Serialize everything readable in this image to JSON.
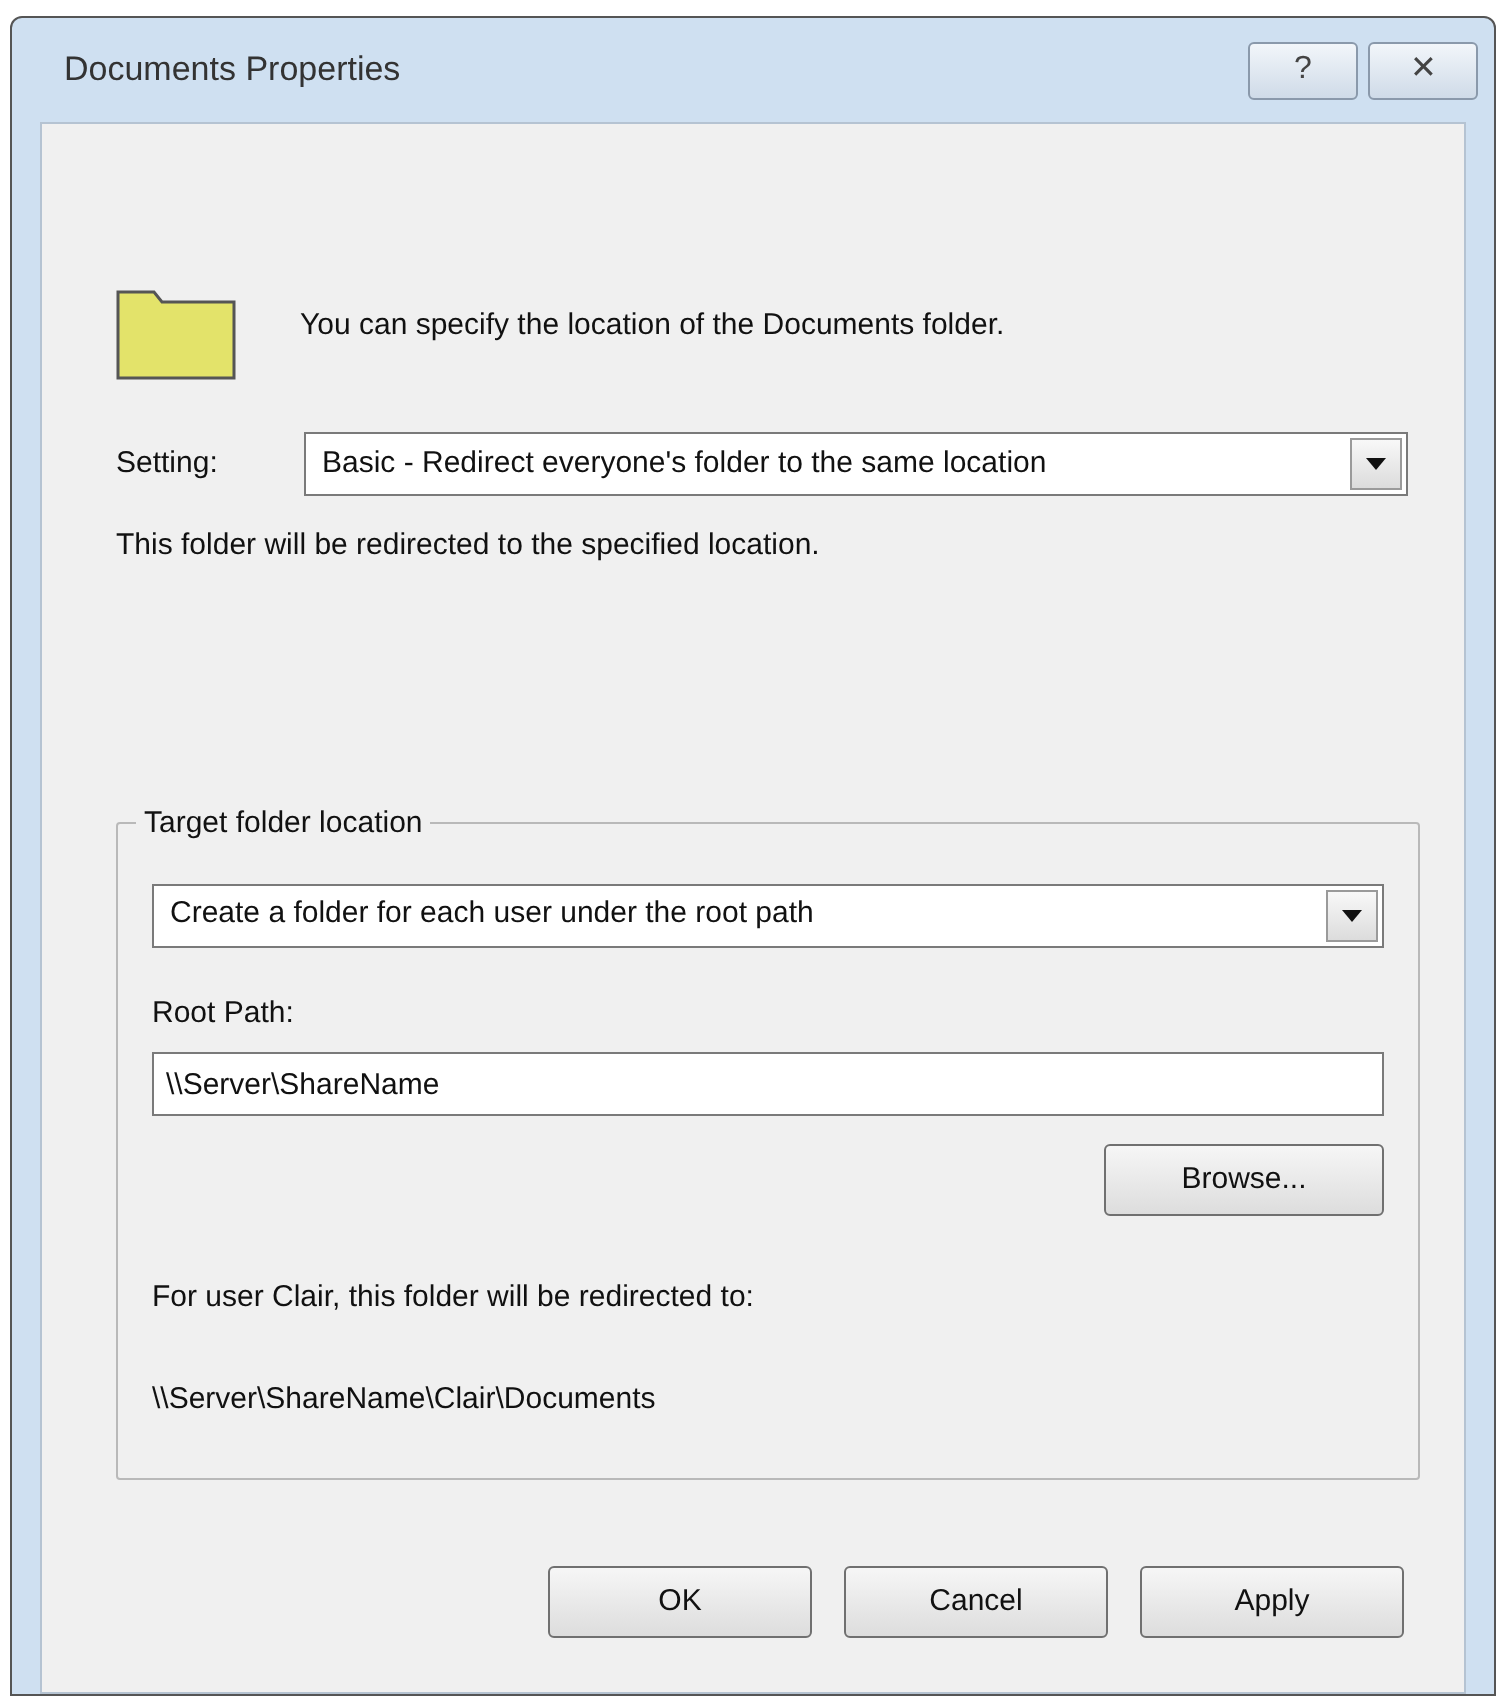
{
  "window": {
    "title": "Documents Properties",
    "title_buttons": [
      "?",
      "✕"
    ]
  },
  "intro": "You can specify the location of the Documents folder.",
  "setting": {
    "label": "Setting:",
    "value": "Basic - Redirect everyone's folder to the same location"
  },
  "setting_note": "This folder will be redirected to the specified location.",
  "target": {
    "legend": "Target folder location",
    "option": "Create a folder for each user under the root path",
    "root_path_label": "Root Path:",
    "root_path": "\\\\Server\\ShareName",
    "browse": "Browse...",
    "user_note": "For user Clair, this folder will be redirected to:",
    "user_path": "\\\\Server\\ShareName\\Clair\\Documents"
  },
  "buttons": [
    "OK",
    "Cancel",
    "Apply"
  ]
}
